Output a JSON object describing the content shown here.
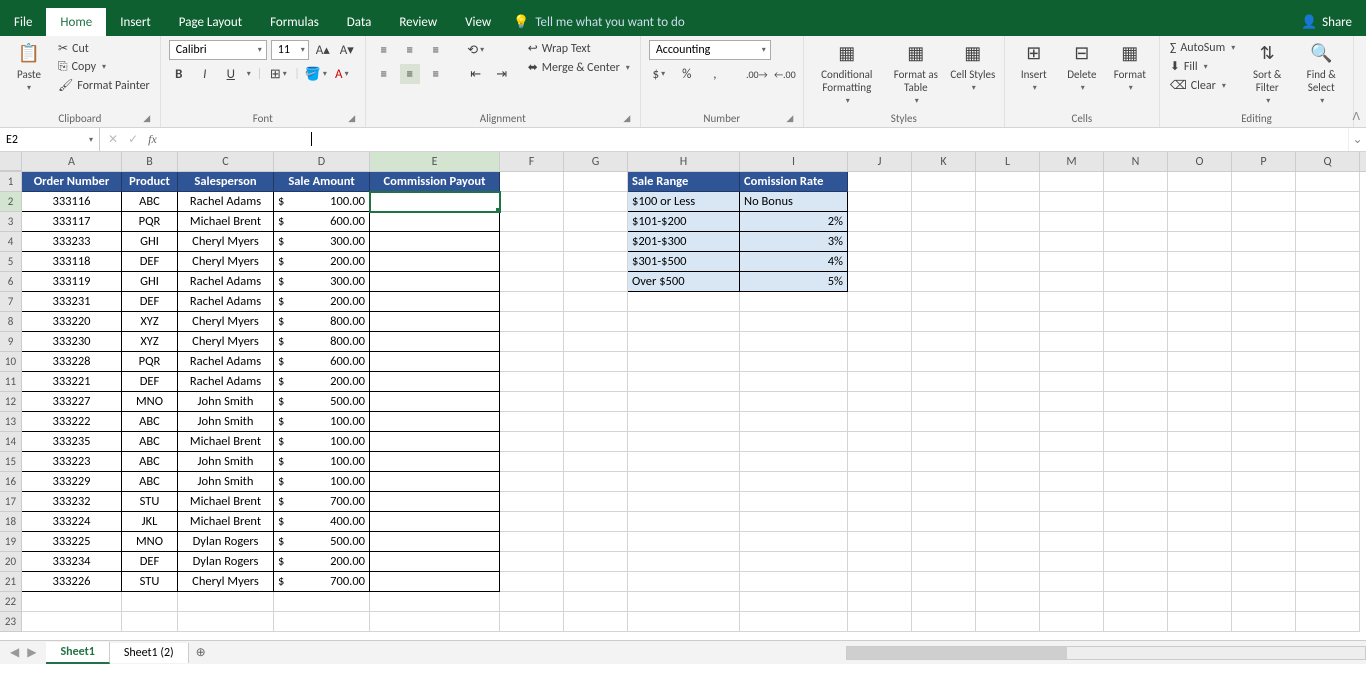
{
  "tabs": {
    "file": "File",
    "home": "Home",
    "insert": "Insert",
    "pagelayout": "Page Layout",
    "formulas": "Formulas",
    "data": "Data",
    "review": "Review",
    "view": "View",
    "tellme": "Tell me what you want to do",
    "share": "Share"
  },
  "ribbon": {
    "clipboard": {
      "paste": "Paste",
      "cut": "Cut",
      "copy": "Copy",
      "fp": "Format Painter",
      "label": "Clipboard"
    },
    "font": {
      "name": "Calibri",
      "size": "11",
      "label": "Font"
    },
    "alignment": {
      "wrap": "Wrap Text",
      "merge": "Merge & Center",
      "label": "Alignment"
    },
    "number": {
      "fmt": "Accounting",
      "label": "Number"
    },
    "styles": {
      "cf": "Conditional Formatting",
      "fat": "Format as Table",
      "cs": "Cell Styles",
      "label": "Styles"
    },
    "cells": {
      "insert": "Insert",
      "delete": "Delete",
      "format": "Format",
      "label": "Cells"
    },
    "editing": {
      "autosum": "AutoSum",
      "fill": "Fill",
      "clear": "Clear",
      "sort": "Sort & Filter",
      "find": "Find & Select",
      "label": "Editing"
    }
  },
  "namebox": "E2",
  "cols": [
    "A",
    "B",
    "C",
    "D",
    "E",
    "F",
    "G",
    "H",
    "I",
    "J",
    "K",
    "L",
    "M",
    "N",
    "O",
    "P",
    "Q"
  ],
  "headers": {
    "A": "Order Number",
    "B": "Product",
    "C": "Salesperson",
    "D": "Sale Amount",
    "E": "Commission Payout",
    "H": "Sale Range",
    "I": "Comission Rate"
  },
  "rows": [
    {
      "n": "333116",
      "p": "ABC",
      "s": "Rachel Adams",
      "a": "100.00"
    },
    {
      "n": "333117",
      "p": "PQR",
      "s": "Michael Brent",
      "a": "600.00"
    },
    {
      "n": "333233",
      "p": "GHI",
      "s": "Cheryl Myers",
      "a": "300.00"
    },
    {
      "n": "333118",
      "p": "DEF",
      "s": "Cheryl Myers",
      "a": "200.00"
    },
    {
      "n": "333119",
      "p": "GHI",
      "s": "Rachel Adams",
      "a": "300.00"
    },
    {
      "n": "333231",
      "p": "DEF",
      "s": "Rachel Adams",
      "a": "200.00"
    },
    {
      "n": "333220",
      "p": "XYZ",
      "s": "Cheryl Myers",
      "a": "800.00"
    },
    {
      "n": "333230",
      "p": "XYZ",
      "s": "Cheryl Myers",
      "a": "800.00"
    },
    {
      "n": "333228",
      "p": "PQR",
      "s": "Rachel Adams",
      "a": "600.00"
    },
    {
      "n": "333221",
      "p": "DEF",
      "s": "Rachel Adams",
      "a": "200.00"
    },
    {
      "n": "333227",
      "p": "MNO",
      "s": "John Smith",
      "a": "500.00"
    },
    {
      "n": "333222",
      "p": "ABC",
      "s": "John Smith",
      "a": "100.00"
    },
    {
      "n": "333235",
      "p": "ABC",
      "s": "Michael Brent",
      "a": "100.00"
    },
    {
      "n": "333223",
      "p": "ABC",
      "s": "John Smith",
      "a": "100.00"
    },
    {
      "n": "333229",
      "p": "ABC",
      "s": "John Smith",
      "a": "100.00"
    },
    {
      "n": "333232",
      "p": "STU",
      "s": "Michael Brent",
      "a": "700.00"
    },
    {
      "n": "333224",
      "p": "JKL",
      "s": "Michael Brent",
      "a": "400.00"
    },
    {
      "n": "333225",
      "p": "MNO",
      "s": "Dylan Rogers",
      "a": "500.00"
    },
    {
      "n": "333234",
      "p": "DEF",
      "s": "Dylan Rogers",
      "a": "200.00"
    },
    {
      "n": "333226",
      "p": "STU",
      "s": "Cheryl Myers",
      "a": "700.00"
    }
  ],
  "lookup": [
    {
      "r": "$100 or Less",
      "c": "No Bonus"
    },
    {
      "r": "$101-$200",
      "c": "2%"
    },
    {
      "r": "$201-$300",
      "c": "3%"
    },
    {
      "r": "$301-$500",
      "c": "4%"
    },
    {
      "r": "Over $500",
      "c": "5%"
    }
  ],
  "sheets": {
    "s1": "Sheet1",
    "s2": "Sheet1 (2)"
  },
  "currency": "$"
}
